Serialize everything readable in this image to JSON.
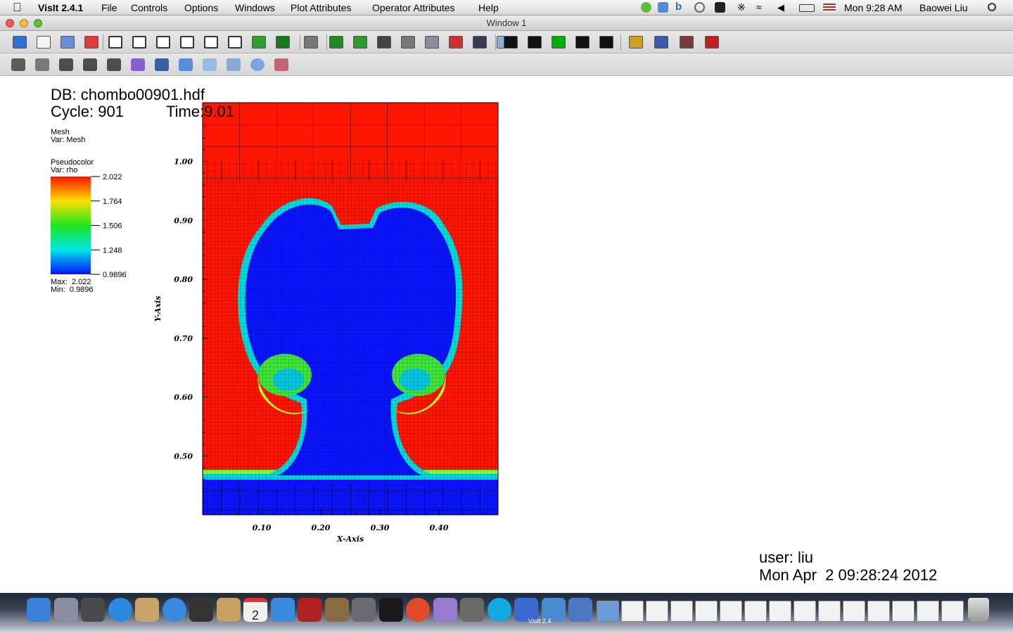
{
  "menubar": {
    "app_name": "VisIt 2.4.1",
    "menus": [
      "File",
      "Controls",
      "Options",
      "Windows",
      "Plot Attributes",
      "Operator Attributes",
      "Help"
    ],
    "clock": "Mon 9:28 AM",
    "user": "Baowei Liu"
  },
  "window": {
    "title": "Window 1"
  },
  "toolbar1": {
    "icons": [
      "active-window-icon",
      "new-window-icon",
      "clone-window-icon",
      "delete-window-icon",
      "layout-1x1-icon",
      "layout-1x2-icon",
      "layout-2x2-icon",
      "layout-2x3-icon",
      "layout-2x4-icon",
      "layout-3x3-icon",
      "lock-view-icon",
      "lock-time-icon",
      "perspective-icon",
      "draw-plots-icon",
      "clear-plots-icon",
      "save-image-icon",
      "copy-image-icon",
      "copy-lighting-icon",
      "copy-view-icon",
      "print-icon",
      "spin-icon",
      "reverse-step-icon",
      "reverse-play-icon",
      "stop-icon",
      "play-icon",
      "forward-step-icon",
      "invert-background-icon",
      "undo-view-icon",
      "redo-view-icon",
      "reset-view-icon"
    ]
  },
  "toolbar2": {
    "icons": [
      "navigate-icon",
      "zoom-icon",
      "zone-pick-icon",
      "node-pick-icon",
      "spreadsheet-pick-icon",
      "lineout-icon",
      "pick-tool-icon",
      "line-tool-icon",
      "plane-tool-icon",
      "box-tool-icon",
      "sphere-tool-icon",
      "point-tool-icon"
    ]
  },
  "plot": {
    "db_label": "DB: chombo00901.hdf",
    "cycle_label": "Cycle: 901",
    "time_label": "Time:9.01",
    "mesh_legend": {
      "title": "Mesh",
      "var": "Var: Mesh"
    },
    "pseudocolor_legend": {
      "title": "Pseudocolor",
      "var": "Var: rho",
      "ticks": [
        "2.022",
        "1.764",
        "1.506",
        "1.248",
        "0.9896"
      ],
      "max": "Max:  2.022",
      "min": "Min:  0.9896"
    },
    "user_label": "user: liu",
    "date_label": "Mon Apr  2 09:28:24 2012"
  },
  "chart_data": {
    "type": "heatmap",
    "variable": "rho",
    "colormap": "hot-desaturated rainbow (blue to red)",
    "xlabel": "X-Axis",
    "ylabel": "Y-Axis",
    "xlim": [
      0.0,
      0.5
    ],
    "ylim": [
      0.4,
      1.1
    ],
    "x_ticks": [
      "0.10",
      "0.20",
      "0.30",
      "0.40"
    ],
    "y_ticks": [
      "1.00",
      "0.90",
      "0.80",
      "0.70",
      "0.60",
      "0.50"
    ],
    "value_range": [
      0.9896,
      2.022
    ],
    "grid": true
  },
  "dock": {
    "apps": [
      "Finder",
      "Launchpad",
      "Dashboard",
      "App Store",
      "Preview",
      "Safari",
      "FaceTime",
      "Contacts",
      "Calendar",
      "iTunes",
      "Photo Booth",
      "iPhoto",
      "System Preferences",
      "Terminal",
      "Chrome",
      "Emacs",
      "Image Capture",
      "Skype",
      "Word",
      "VisIt 2.4",
      "Xcode"
    ],
    "calendar_day": "2",
    "visit_label": "VisIt 2.4"
  }
}
